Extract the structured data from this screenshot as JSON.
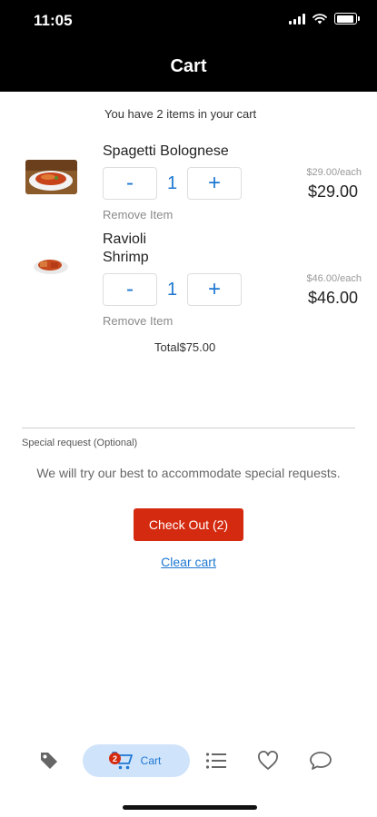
{
  "status_bar": {
    "time": "11:05"
  },
  "header": {
    "title": "Cart"
  },
  "cart": {
    "summary": "You have 2 items in your cart",
    "items": [
      {
        "name": "Spagetti Bolognese",
        "minus": "-",
        "qty": "1",
        "plus": "+",
        "remove_label": "Remove Item",
        "unit_price": "$29.00/each",
        "price": "$29.00"
      },
      {
        "name": "Ravioli Shrimp",
        "name_line1": "Ravioli",
        "name_line2": "Shrimp",
        "minus": "-",
        "qty": "1",
        "plus": "+",
        "remove_label": "Remove Item",
        "unit_price": "$46.00/each",
        "price": "$46.00"
      }
    ],
    "total": "Total$75.00"
  },
  "special_request": {
    "label": "Special request (Optional)",
    "note": "We will try our best to accommodate special requests."
  },
  "actions": {
    "checkout_label": "Check Out (2)",
    "clear_label": "Clear cart"
  },
  "tabbar": {
    "tabs": [
      {
        "icon": "tag-icon"
      },
      {
        "icon": "cart-icon",
        "label": "Cart",
        "badge": "2",
        "active": true
      },
      {
        "icon": "list-icon"
      },
      {
        "icon": "heart-icon"
      },
      {
        "icon": "chat-bubble-icon"
      }
    ]
  },
  "colors": {
    "accent": "#1e78d2",
    "checkout": "#d42a10",
    "active_tab_bg": "#cfe3fb"
  }
}
